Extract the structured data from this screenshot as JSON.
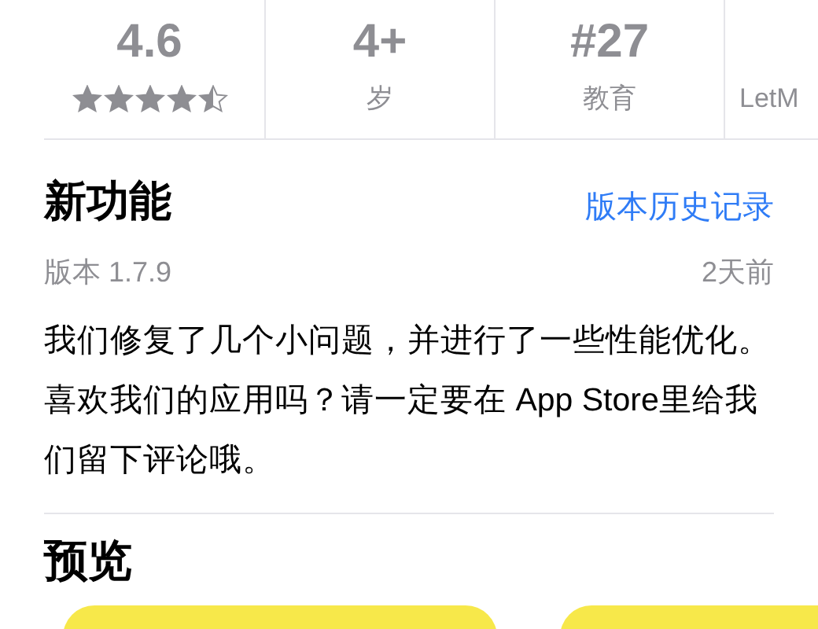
{
  "stats": [
    {
      "kind": "rating",
      "value": "4.6",
      "stars": 4.5
    },
    {
      "kind": "text",
      "value": "4+",
      "label": "岁"
    },
    {
      "kind": "rank",
      "value": "#27",
      "label": "教育"
    },
    {
      "kind": "text",
      "label": "LetM"
    }
  ],
  "whats_new": {
    "title": "新功能",
    "link": "版本历史记录",
    "version": "版本 1.7.9",
    "date": "2天前",
    "notes": "我们修复了几个小问题，并进行了一些性能优化。喜欢我们的应用吗？请一定要在 App Store里给我们留下评论哦。"
  },
  "preview": {
    "title": "预览"
  }
}
